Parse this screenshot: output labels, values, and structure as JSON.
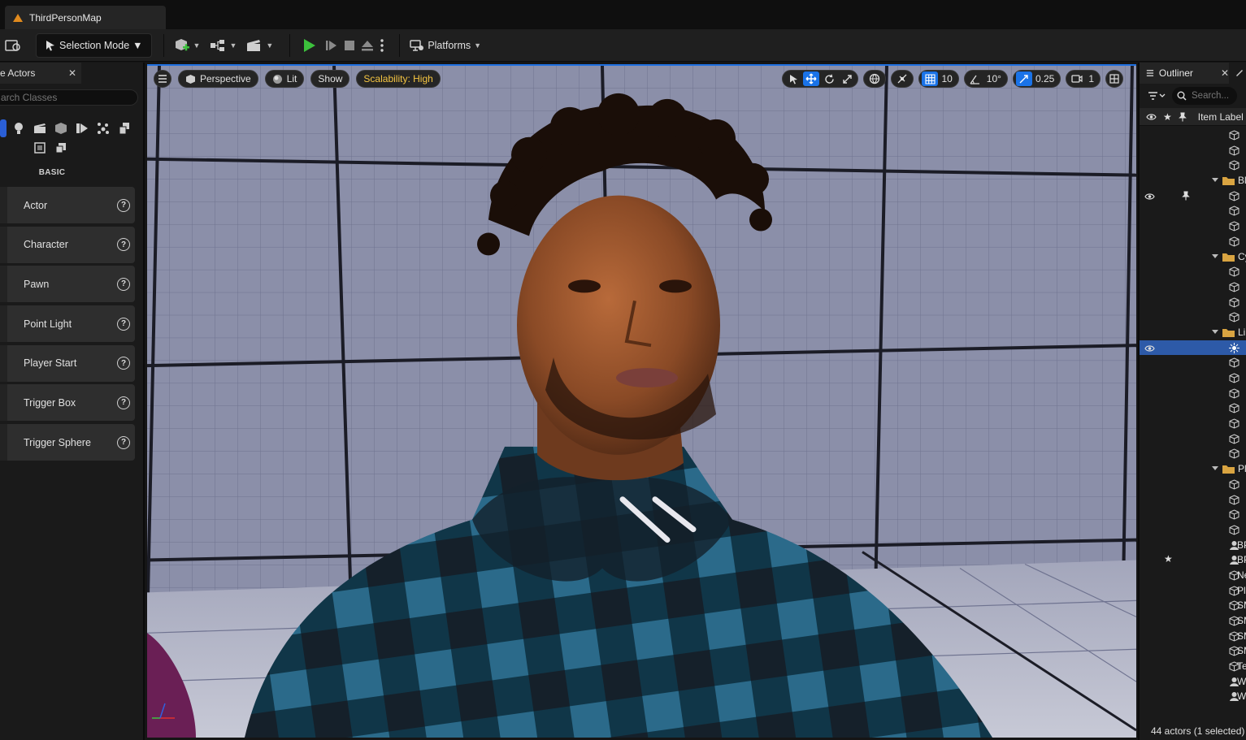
{
  "document_tab": {
    "title": "ThirdPersonMap"
  },
  "toolbar": {
    "selection_mode": "Selection Mode",
    "platforms": "Platforms"
  },
  "place_actors": {
    "tab_title": "e Actors",
    "search_placeholder": "arch Classes",
    "section_label": "BASIC",
    "items": [
      {
        "label": "Actor"
      },
      {
        "label": "Character"
      },
      {
        "label": "Pawn"
      },
      {
        "label": "Point Light"
      },
      {
        "label": "Player Start"
      },
      {
        "label": "Trigger Box"
      },
      {
        "label": "Trigger Sphere"
      }
    ]
  },
  "viewport": {
    "perspective": "Perspective",
    "lit": "Lit",
    "show": "Show",
    "scalability": "Scalability: High",
    "grid_snap": "10",
    "rotation_snap": "10°",
    "scale_snap": "0.25",
    "camera_speed": "1"
  },
  "outliner": {
    "tab_title": "Outliner",
    "search_placeholder": "Search...",
    "column_label": "Item Label",
    "folder_labels": [
      "Bl",
      "Cy",
      "Li",
      "Pl"
    ],
    "item_labels": [
      "BP",
      "BP",
      "Ne",
      "Pl",
      "SM",
      "SM",
      "SM",
      "SM",
      "Te",
      "W",
      "W"
    ],
    "status": "44 actors (1 selected)"
  },
  "colors": {
    "accent": "#1a73e8",
    "play": "#3cc13c",
    "scalability": "#f5c542",
    "folder": "#d9a441"
  }
}
